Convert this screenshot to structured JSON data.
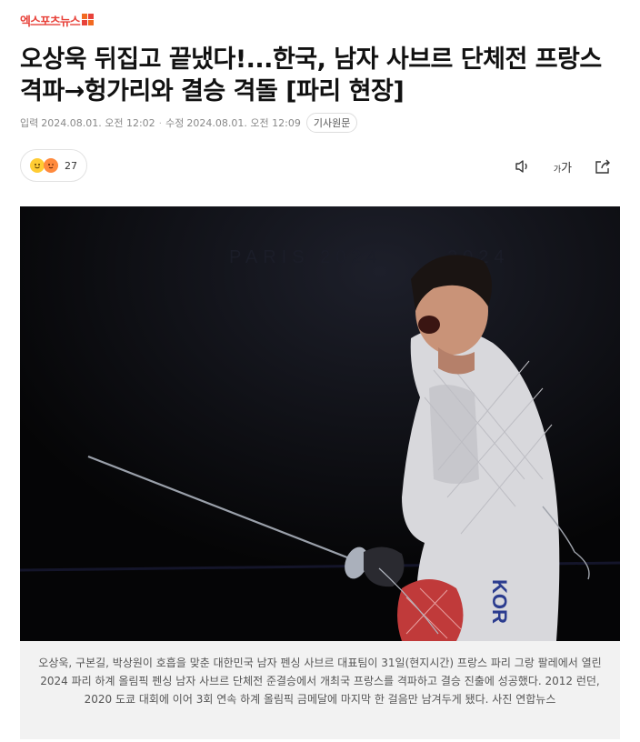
{
  "site": {
    "logo_text": "엑스포츠뉴스"
  },
  "article": {
    "headline": "오상욱 뒤집고 끝냈다!...한국, 남자 사브르 단체전 프랑스 격파→헝가리와 결승 격돌 [파리 현장]",
    "published_label": "입력",
    "published": "2024.08.01. 오전 12:02",
    "updated_label": "수정",
    "updated": "2024.08.01. 오전 12:09",
    "original_button": "기사원문",
    "reaction_count": "27",
    "caption": "오상욱, 구본길, 박상원이 호흡을 맞춘 대한민국 남자 펜싱 사브르 대표팀이 31일(현지시간) 프랑스 파리 그랑 팔레에서 열린 2024 파리 하계 올림픽 펜싱 남자 사브르 단체전 준결승에서 개최국 프랑스를 격파하고 결승 진출에 성공했다. 2012 런던, 2020 도쿄 대회에 이어 3회 연속 하계 올림픽 금메달에 마지막 한 걸음만 남겨두게 됐다. 사진 연합뉴스"
  },
  "photo": {
    "background_text": "PARIS 2024",
    "uniform_text": "KOR"
  },
  "tools": {
    "font_size_small": "가",
    "font_size_large": "가"
  },
  "colors": {
    "brand": "#e8423a",
    "brand_mark": "#f26a21",
    "caption_bg": "#f2f2f2"
  },
  "icons": [
    "speaker-icon",
    "font-size-icon",
    "share-icon"
  ]
}
